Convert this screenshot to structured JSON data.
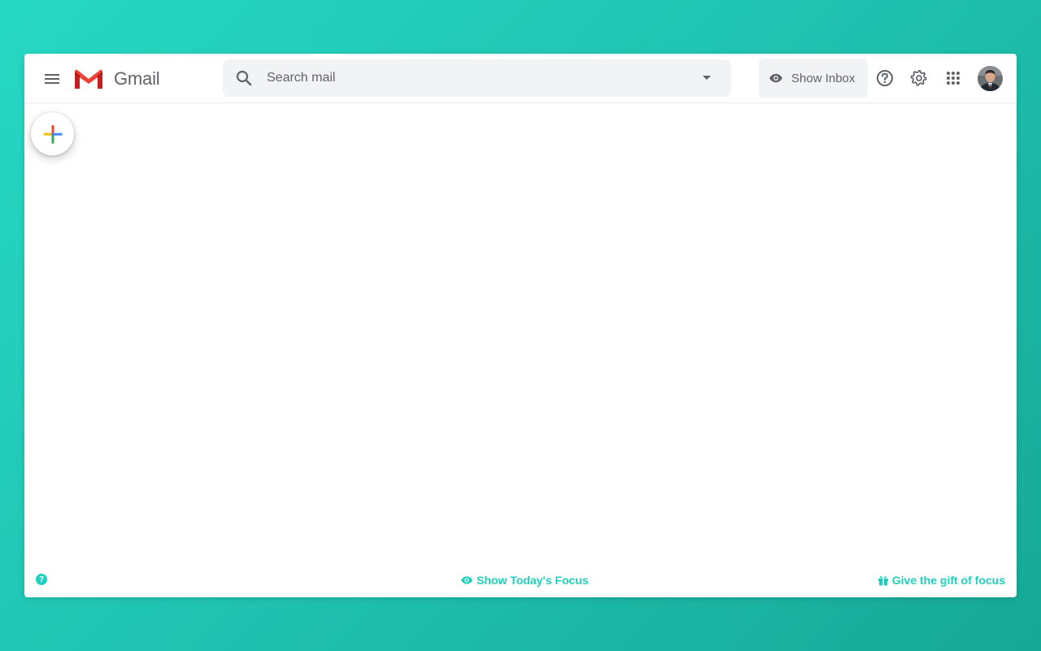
{
  "app": {
    "name": "Gmail"
  },
  "search": {
    "placeholder": "Search mail",
    "value": ""
  },
  "header": {
    "show_inbox_label": "Show Inbox",
    "icons": [
      "menu-icon",
      "gmail-logo",
      "search-icon",
      "dropdown-icon",
      "eye-icon",
      "help-icon",
      "gear-icon",
      "apps-grid-icon",
      "avatar"
    ]
  },
  "compose": {
    "icon": "plus-icon"
  },
  "footer": {
    "help_glyph": "?",
    "focus_label": "Show Today's Focus",
    "gift_label": "Give the gift of focus"
  },
  "colors": {
    "background": "#1fcfbb",
    "accent": "#1fcfbb",
    "gmail_red": "#ea4335",
    "plus_blue": "#4285f4",
    "plus_red": "#ea4335",
    "plus_yellow": "#fbbc04",
    "plus_green": "#34a853"
  }
}
